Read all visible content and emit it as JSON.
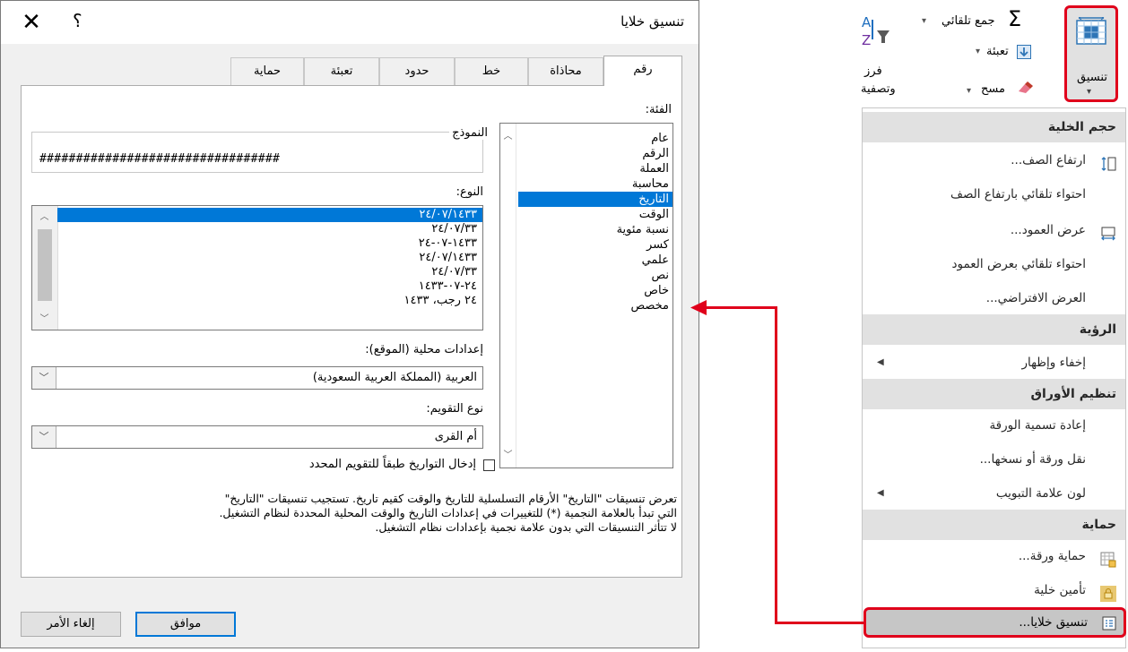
{
  "dialog": {
    "title": "تنسيق خلايا",
    "help": "؟",
    "close": "✕",
    "tabs": [
      "رقم",
      "محاذاة",
      "خط",
      "حدود",
      "تعبئة",
      "حماية"
    ],
    "category_label": "الفئة:",
    "categories": [
      "عام",
      "الرقم",
      "العملة",
      "محاسبة",
      "التاريخ",
      "الوقت",
      "نسبة مئوية",
      "كسر",
      "علمي",
      "نص",
      "خاص",
      "مخصص"
    ],
    "selected_category": "التاريخ",
    "sample_label": "النموذج",
    "sample_value": "#################################",
    "type_label": "النوع:",
    "types": [
      "٢٤/٠٧/١٤٣٣",
      "٢٤/٠٧/٣٣",
      "١٤٣٣-٠٧-٢٤",
      "٢٤/٠٧/١٤٣٣",
      "٢٤/٠٧/٣٣",
      "٢٤-٠٧-١٤٣٣",
      "٢٤ رجب، ١٤٣٣"
    ],
    "locale_label": "إعدادات محلية (الموقع):",
    "locale_value": "العربية (المملكة العربية السعودية)",
    "calendar_label": "نوع التقويم:",
    "calendar_value": "أم القرى",
    "checkbox_label": "إدخال التواريخ طبقاً للتقويم المحدد",
    "description_line1": "تعرض تنسيقات \"التاريخ\" الأرقام التسلسلية للتاريخ والوقت كقيم تاريخ. تستجيب تنسيقات \"التاريخ\"",
    "description_line2": "التي تبدأ بالعلامة النجمية (*) للتغييرات في إعدادات التاريخ والوقت المحلية المحددة لنظام التشغيل.",
    "description_line3": "لا تتأثر التنسيقات التي بدون علامة نجمية بإعدادات نظام التشغيل.",
    "ok": "موافق",
    "cancel": "إلغاء الأمر"
  },
  "ribbon": {
    "autosum": "جمع تلقائي",
    "fill": "تعبئة",
    "clear": "مسح",
    "sort_filter_1": "فرز",
    "sort_filter_2": "وتصفية",
    "format": "تنسيق"
  },
  "menu": {
    "cell_size_header": "حجم الخلية",
    "row_height": "ارتفاع الصف...",
    "autofit_row": "احتواء تلقائي بارتفاع الصف",
    "column_width": "عرض العمود...",
    "autofit_column": "احتواء تلقائي بعرض العمود",
    "default_width": "العرض الافتراضي...",
    "visibility_header": "الرؤية",
    "hide_unhide": "إخفاء وإظهار",
    "organize_header": "تنظيم الأوراق",
    "rename_sheet": "إعادة تسمية الورقة",
    "move_copy": "نقل ورقة أو نسخها...",
    "tab_color": "لون علامة التبويب",
    "protection_header": "حماية",
    "protect_sheet": "حماية ورقة...",
    "lock_cell": "تأمين خلية",
    "format_cells": "تنسيق خلايا..."
  },
  "colors": {
    "accent": "#0078d7",
    "highlight": "#e0001b"
  }
}
